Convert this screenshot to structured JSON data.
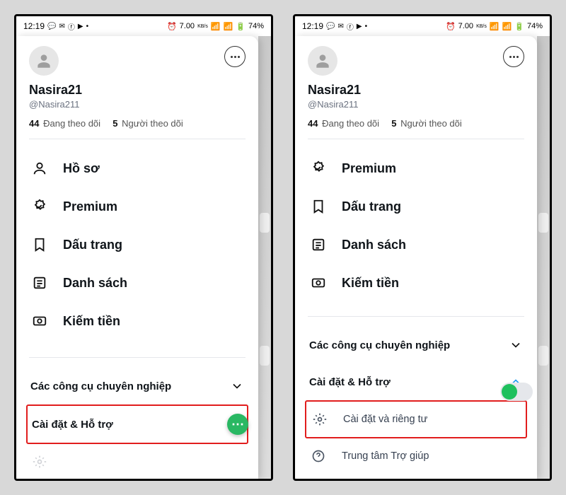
{
  "status": {
    "time": "12:19",
    "kbs": "7.00",
    "kbs_unit": "KB/s",
    "battery": "74%"
  },
  "profile": {
    "display_name": "Nasira21",
    "handle": "@Nasira211",
    "following_count": "44",
    "following_label": "Đang theo dõi",
    "followers_count": "5",
    "followers_label": "Người theo dõi"
  },
  "left": {
    "menu": [
      {
        "icon": "person",
        "label": "Hồ sơ"
      },
      {
        "icon": "badge",
        "label": "Premium"
      },
      {
        "icon": "bookmark",
        "label": "Dấu trang"
      },
      {
        "icon": "list",
        "label": "Danh sách"
      },
      {
        "icon": "money",
        "label": "Kiếm tiền"
      }
    ],
    "section_tools": "Các công cụ chuyên nghiệp",
    "section_settings": "Cài đặt & Hỗ trợ"
  },
  "right": {
    "menu": [
      {
        "icon": "badge",
        "label": "Premium"
      },
      {
        "icon": "bookmark",
        "label": "Dấu trang"
      },
      {
        "icon": "list",
        "label": "Danh sách"
      },
      {
        "icon": "money",
        "label": "Kiếm tiền"
      }
    ],
    "section_tools": "Các công cụ chuyên nghiệp",
    "section_settings": "Cài đặt & Hỗ trợ",
    "sub_settings": "Cài đặt và riêng tư",
    "sub_help": "Trung tâm Trợ giúp"
  }
}
